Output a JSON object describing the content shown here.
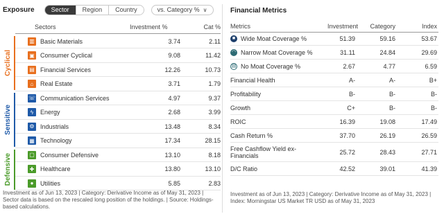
{
  "exposure": {
    "title": "Exposure",
    "tabs": [
      "Sector",
      "Region",
      "Country"
    ],
    "active_tab": "Sector",
    "compare_select": "vs. Category %",
    "columns": {
      "sectors": "Sectors",
      "investment": "Investment %",
      "category": "Cat %"
    },
    "groups": [
      {
        "label": "Cyclical",
        "color": "#e86f1e"
      },
      {
        "label": "Sensitive",
        "color": "#1f5aa8"
      },
      {
        "label": "Defensive",
        "color": "#4b9b2a"
      }
    ],
    "rows": [
      {
        "name": "Basic Materials",
        "icon": "basic-materials-icon",
        "glyph": "▥",
        "color": "#e86f1e",
        "investment": "3.74",
        "category": "2.11"
      },
      {
        "name": "Consumer Cyclical",
        "icon": "consumer-cyclical-icon",
        "glyph": "▣",
        "color": "#e86f1e",
        "investment": "9.08",
        "category": "11.42"
      },
      {
        "name": "Financial Services",
        "icon": "financial-services-icon",
        "glyph": "▤",
        "color": "#e86f1e",
        "investment": "12.26",
        "category": "10.73"
      },
      {
        "name": "Real Estate",
        "icon": "real-estate-icon",
        "glyph": "⌂",
        "color": "#e86f1e",
        "investment": "3.71",
        "category": "1.79"
      },
      {
        "name": "Communication Services",
        "icon": "communication-services-icon",
        "glyph": "☏",
        "color": "#1f5aa8",
        "investment": "4.97",
        "category": "9.37"
      },
      {
        "name": "Energy",
        "icon": "energy-icon",
        "glyph": "ϟ",
        "color": "#1f5aa8",
        "investment": "2.68",
        "category": "3.99"
      },
      {
        "name": "Industrials",
        "icon": "industrials-icon",
        "glyph": "⚙",
        "color": "#1f5aa8",
        "investment": "13.48",
        "category": "8.34"
      },
      {
        "name": "Technology",
        "icon": "technology-icon",
        "glyph": "▦",
        "color": "#1f5aa8",
        "investment": "17.34",
        "category": "28.15"
      },
      {
        "name": "Consumer Defensive",
        "icon": "consumer-defensive-icon",
        "glyph": "▢",
        "color": "#4b9b2a",
        "investment": "13.10",
        "category": "8.18"
      },
      {
        "name": "Healthcare",
        "icon": "healthcare-icon",
        "glyph": "✚",
        "color": "#4b9b2a",
        "investment": "13.80",
        "category": "13.10"
      },
      {
        "name": "Utilities",
        "icon": "utilities-icon",
        "glyph": "●",
        "color": "#4b9b2a",
        "investment": "5.85",
        "category": "2.83"
      }
    ],
    "footnote": "Investment as of Jun 13, 2023 | Category: Derivative Income as of May 31, 2023 | Sector data is based on the rescaled long position of the holdings. | Source: Holdings-based calculations."
  },
  "financial_metrics": {
    "title": "Financial Metrics",
    "columns": {
      "metrics": "Metrics",
      "investment": "Investment",
      "category": "Category",
      "index": "Index"
    },
    "rows": [
      {
        "name": "Wide Moat Coverage %",
        "icon": "wide-moat-icon",
        "investment": "51.39",
        "category": "59.16",
        "index": "53.67"
      },
      {
        "name": "Narrow Moat Coverage %",
        "icon": "narrow-moat-icon",
        "investment": "31.11",
        "category": "24.84",
        "index": "29.69"
      },
      {
        "name": "No Moat Coverage %",
        "icon": "no-moat-icon",
        "investment": "2.67",
        "category": "4.77",
        "index": "6.59"
      },
      {
        "name": "Financial Health",
        "icon": "",
        "investment": "A-",
        "category": "A-",
        "index": "B+"
      },
      {
        "name": "Profitability",
        "icon": "",
        "investment": "B-",
        "category": "B-",
        "index": "B-"
      },
      {
        "name": "Growth",
        "icon": "",
        "investment": "C+",
        "category": "B-",
        "index": "B-"
      },
      {
        "name": "ROIC",
        "icon": "",
        "investment": "16.39",
        "category": "19.08",
        "index": "17.49"
      },
      {
        "name": "Cash Return %",
        "icon": "",
        "investment": "37.70",
        "category": "26.19",
        "index": "26.59"
      },
      {
        "name": "Free Cashflow Yield ex-Financials",
        "icon": "",
        "investment": "25.72",
        "category": "28.43",
        "index": "27.71"
      },
      {
        "name": "D/C Ratio",
        "icon": "",
        "investment": "42.52",
        "category": "39.01",
        "index": "41.39"
      }
    ],
    "footnote": "Investment as of Jun 13, 2023 | Category: Derivative Income as of May 31, 2023 | Index: Morningstar US Market TR USD as of May 31, 2023"
  }
}
